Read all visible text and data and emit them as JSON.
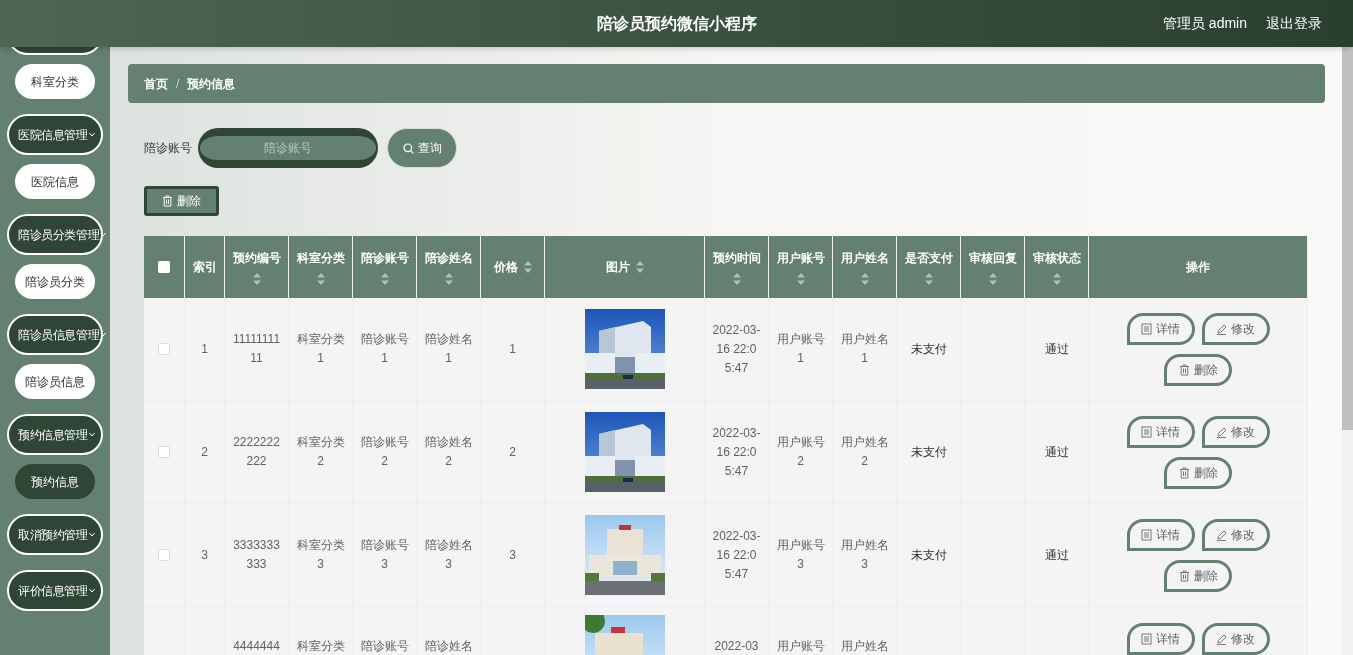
{
  "header": {
    "title": "陪诊员预约微信小程序",
    "user": "管理员 admin",
    "logout": "退出登录"
  },
  "sidebar": {
    "items": [
      {
        "kind": "sub",
        "label": "科室分类",
        "selected": false
      },
      {
        "kind": "group",
        "label": "医院信息管理"
      },
      {
        "kind": "sub",
        "label": "医院信息",
        "selected": false
      },
      {
        "kind": "group",
        "label": "陪诊员分类管理"
      },
      {
        "kind": "sub",
        "label": "陪诊员分类",
        "selected": false
      },
      {
        "kind": "group",
        "label": "陪诊员信息管理"
      },
      {
        "kind": "sub",
        "label": "陪诊员信息",
        "selected": false
      },
      {
        "kind": "group",
        "label": "预约信息管理"
      },
      {
        "kind": "sub",
        "label": "预约信息",
        "selected": true
      },
      {
        "kind": "group",
        "label": "取消预约管理"
      },
      {
        "kind": "group",
        "label": "评价信息管理"
      }
    ]
  },
  "breadcrumb": {
    "items": [
      "首页",
      "预约信息"
    ],
    "separator": "/"
  },
  "search": {
    "label": "陪诊账号",
    "placeholder": "陪诊账号",
    "button": "查询"
  },
  "delete_button": "删除",
  "table": {
    "select_all": {
      "checked": false
    },
    "columns": [
      {
        "label": "索引",
        "sortable": false
      },
      {
        "label": "预约编号",
        "sortable": true
      },
      {
        "label": "科室分类",
        "sortable": true
      },
      {
        "label": "陪诊账号",
        "sortable": true
      },
      {
        "label": "陪诊姓名",
        "sortable": true
      },
      {
        "label": "价格",
        "sortable": true
      },
      {
        "label": "图片",
        "sortable": true
      },
      {
        "label": "预约时间",
        "sortable": true
      },
      {
        "label": "用户账号",
        "sortable": true
      },
      {
        "label": "用户姓名",
        "sortable": true
      },
      {
        "label": "是否支付",
        "sortable": true
      },
      {
        "label": "审核回复",
        "sortable": true
      },
      {
        "label": "审核状态",
        "sortable": true
      },
      {
        "label": "操作",
        "sortable": false
      }
    ],
    "rows": [
      {
        "selected": false,
        "index": "1",
        "code": "1111111111",
        "department": "科室分类1",
        "companion_account": "陪诊账号1",
        "companion_name": "陪诊姓名1",
        "price": "1",
        "picture": {
          "kind": "picture"
        },
        "time": "2022-03-16 22:05:47",
        "user_account": "用户账号1",
        "user_name": "用户姓名1",
        "paid": "未支付",
        "review_status": "通过",
        "actions": [
          {
            "kind": "detail",
            "label": "详情"
          },
          {
            "kind": "edit",
            "label": "修改"
          },
          {
            "kind": "delete",
            "label": "删除"
          }
        ]
      },
      {
        "selected": false,
        "index": "2",
        "code": "2222222222",
        "department": "科室分类2",
        "companion_account": "陪诊账号2",
        "companion_name": "陪诊姓名2",
        "price": "2",
        "picture": {
          "kind": "picture"
        },
        "time": "2022-03-16 22:05:47",
        "user_account": "用户账号2",
        "user_name": "用户姓名2",
        "paid": "未支付",
        "review_status": "通过",
        "actions": [
          {
            "kind": "detail",
            "label": "详情"
          },
          {
            "kind": "edit",
            "label": "修改"
          },
          {
            "kind": "delete",
            "label": "删除"
          }
        ]
      },
      {
        "selected": false,
        "index": "3",
        "code": "3333333333",
        "department": "科室分类3",
        "companion_account": "陪诊账号3",
        "companion_name": "陪诊姓名3",
        "price": "3",
        "picture": {
          "kind": "picture"
        },
        "time": "2022-03-16 22:05:47",
        "user_account": "用户账号3",
        "user_name": "用户姓名3",
        "paid": "未支付",
        "review_status": "通过",
        "actions": [
          {
            "kind": "detail",
            "label": "详情"
          },
          {
            "kind": "edit",
            "label": "修改"
          },
          {
            "kind": "delete",
            "label": "删除"
          }
        ]
      },
      {
        "code": "4444444",
        "department": "科室分类",
        "companion_account": "陪诊账号",
        "companion_name": "陪诊姓名",
        "picture": {
          "kind": "picture"
        },
        "time": "2022-03",
        "user_account": "用户账号",
        "user_name": "用户姓名",
        "actions": [
          {
            "kind": "detail",
            "label": "详情"
          },
          {
            "kind": "edit",
            "label": "修改"
          }
        ]
      }
    ]
  }
}
